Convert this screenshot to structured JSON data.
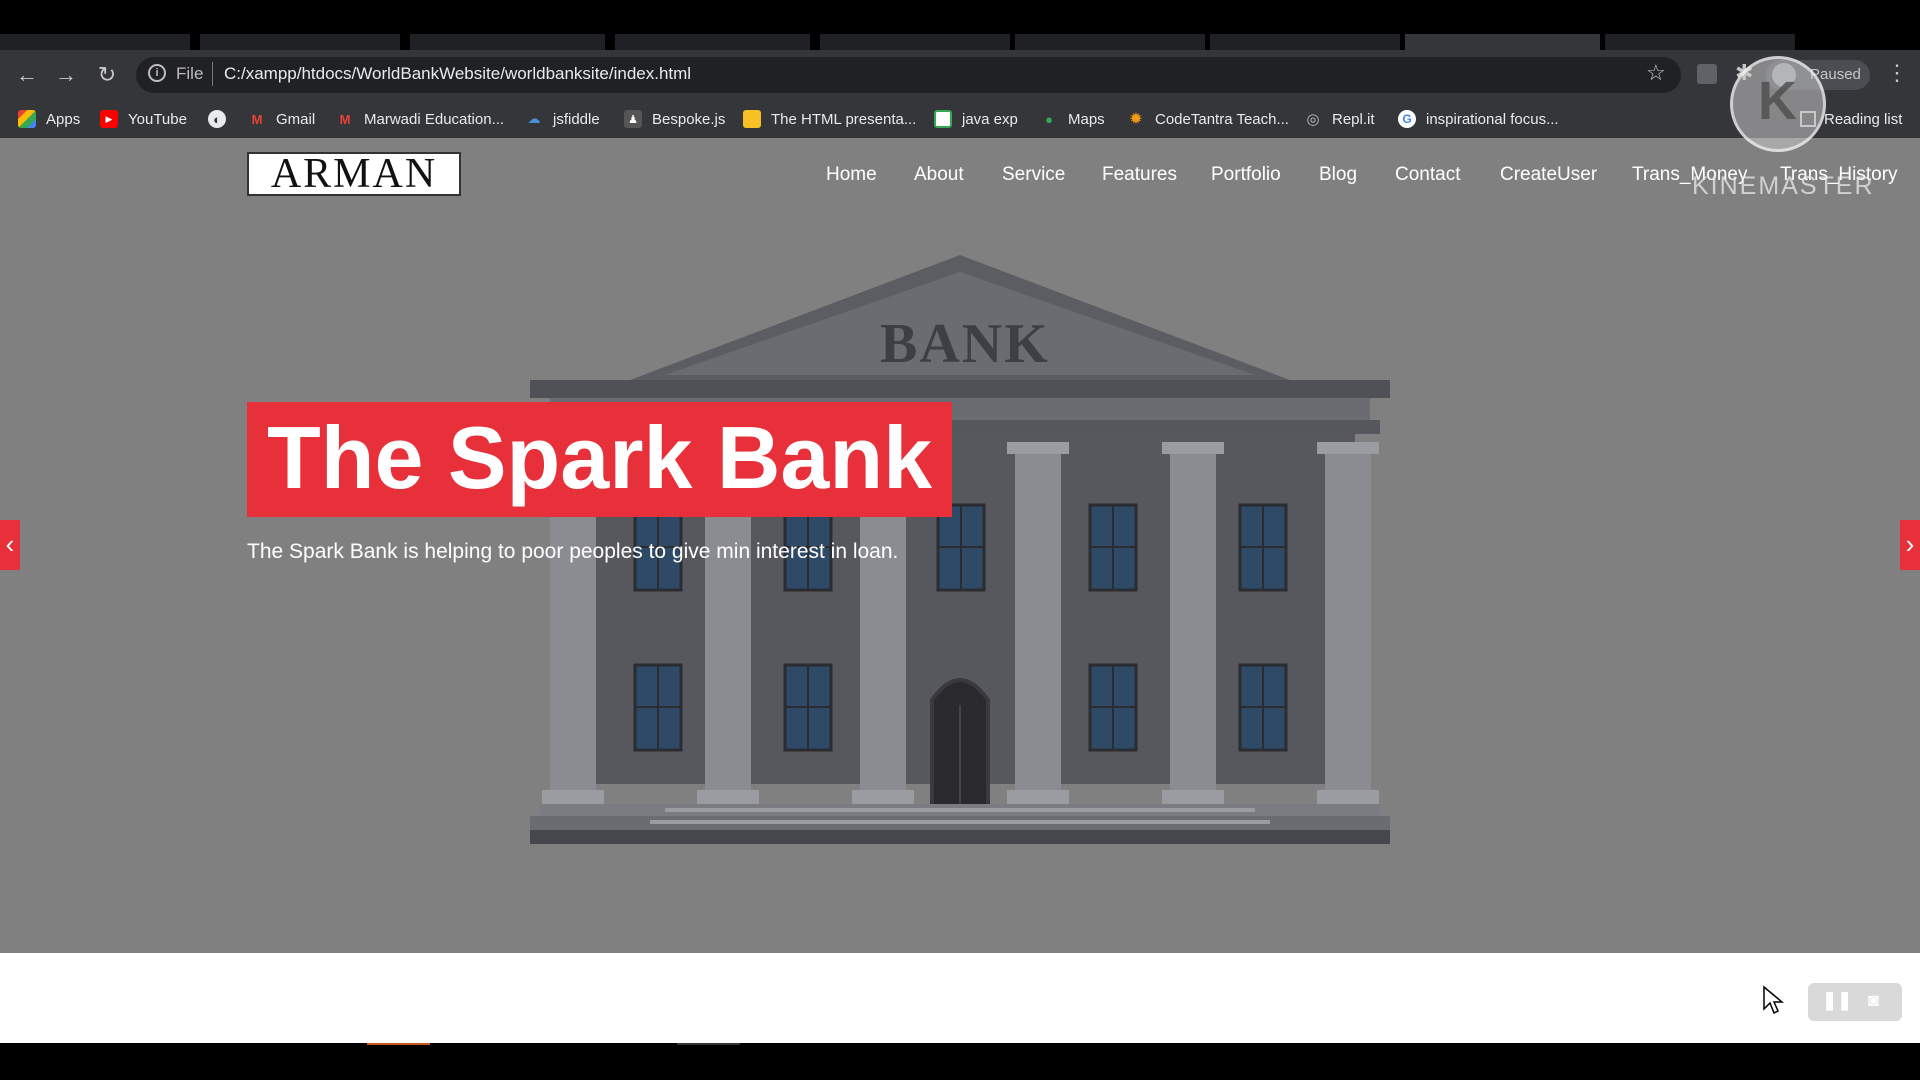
{
  "browser": {
    "url_scheme_label": "File",
    "url": "C:/xampp/htdocs/WorldBankWebsite/worldbanksite/index.html",
    "profile_status": "Paused",
    "reading_list_label": "Reading list",
    "bookmarks": [
      {
        "label": "Apps",
        "icon": "apps-grid-icon"
      },
      {
        "label": "YouTube",
        "icon": "youtube-icon"
      },
      {
        "label": "",
        "icon": "globe-icon"
      },
      {
        "label": "Gmail",
        "icon": "gmail-icon"
      },
      {
        "label": "Marwadi Education...",
        "icon": "gmail-icon"
      },
      {
        "label": "jsfiddle",
        "icon": "cloud-icon"
      },
      {
        "label": "Bespoke.js",
        "icon": "bespoke-icon"
      },
      {
        "label": "The HTML presenta...",
        "icon": "folder-icon"
      },
      {
        "label": "java exp",
        "icon": "google-sheets-icon"
      },
      {
        "label": "Maps",
        "icon": "maps-pin-icon"
      },
      {
        "label": "CodeTantra Teach...",
        "icon": "sun-icon"
      },
      {
        "label": "Repl.it",
        "icon": "replit-icon"
      },
      {
        "label": "inspirational focus...",
        "icon": "google-icon"
      }
    ]
  },
  "site": {
    "logo_text": "ARMAN",
    "menu": [
      "Home",
      "About",
      "Service",
      "Features",
      "Portfolio",
      "Blog",
      "Contact",
      "CreateUser",
      "Trans_Money",
      "Trans_History"
    ],
    "hero": {
      "title": "The Spark Bank",
      "subtitle": "The Spark Bank is helping to poor peoples to give min interest in loan.",
      "image_sign": "BANK"
    },
    "prev_arrow": "‹",
    "next_arrow": "›"
  },
  "overlay": {
    "watermark": "KINEMASTER",
    "watermark_glyph": "K"
  },
  "colors": {
    "accent_red": "#e8303a",
    "page_overlay": "#808080",
    "chrome_dark": "#35363a"
  }
}
